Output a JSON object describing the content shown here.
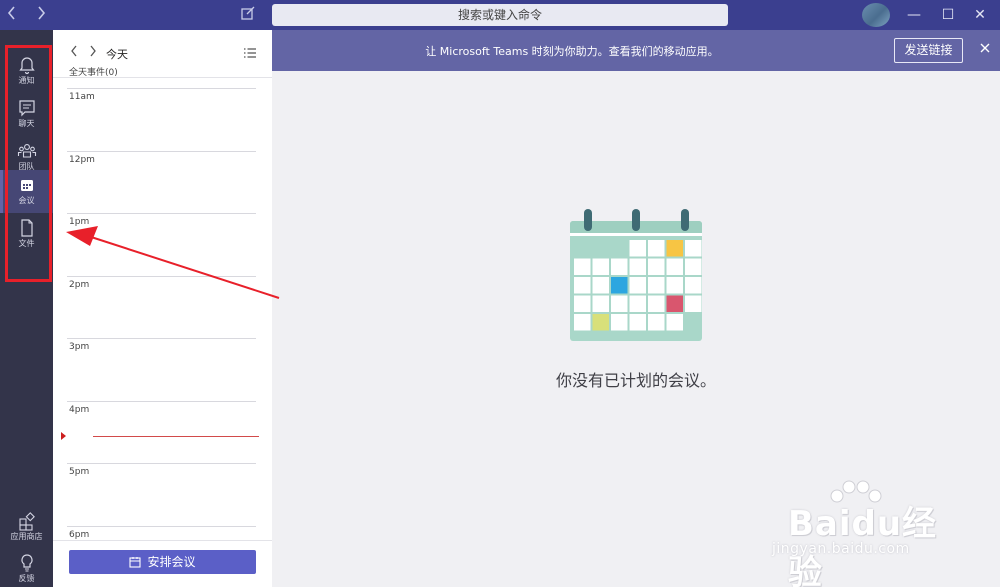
{
  "titlebar": {
    "search_placeholder": "搜索或键入命令",
    "back_icon": "chevron-left-icon",
    "forward_icon": "chevron-right-icon",
    "compose_icon": "compose-icon",
    "minimize": "—",
    "maximize": "☐",
    "close": "✕"
  },
  "rail": {
    "items": [
      {
        "label": "通知",
        "icon": "bell-icon"
      },
      {
        "label": "聊天",
        "icon": "chat-icon"
      },
      {
        "label": "团队",
        "icon": "teams-icon"
      },
      {
        "label": "会议",
        "icon": "calendar-icon",
        "active": true
      },
      {
        "label": "文件",
        "icon": "file-icon"
      }
    ],
    "bottom_items": [
      {
        "label": "应用商店",
        "icon": "store-icon"
      },
      {
        "label": "反馈",
        "icon": "lightbulb-icon"
      }
    ]
  },
  "calendar": {
    "prev": "‹",
    "next": "›",
    "today_label": "今天",
    "all_day": "全天事件(0)",
    "slots": [
      "11am",
      "12pm",
      "1pm",
      "2pm",
      "3pm",
      "4pm",
      "5pm",
      "6pm"
    ],
    "schedule_button": "安排会议"
  },
  "banner": {
    "text": "让 Microsoft Teams 时刻为你助力。查看我们的移动应用。",
    "send_link": "发送链接",
    "close": "✕"
  },
  "main": {
    "empty_message": "你没有已计划的会议。"
  },
  "watermark": {
    "brand": "Baidu经验",
    "url": "jingyan.baidu.com"
  },
  "colors": {
    "accent": "#6264a7",
    "titlebar": "#3b3f8f",
    "rail": "#33344a",
    "annotation": "#e8202a"
  }
}
